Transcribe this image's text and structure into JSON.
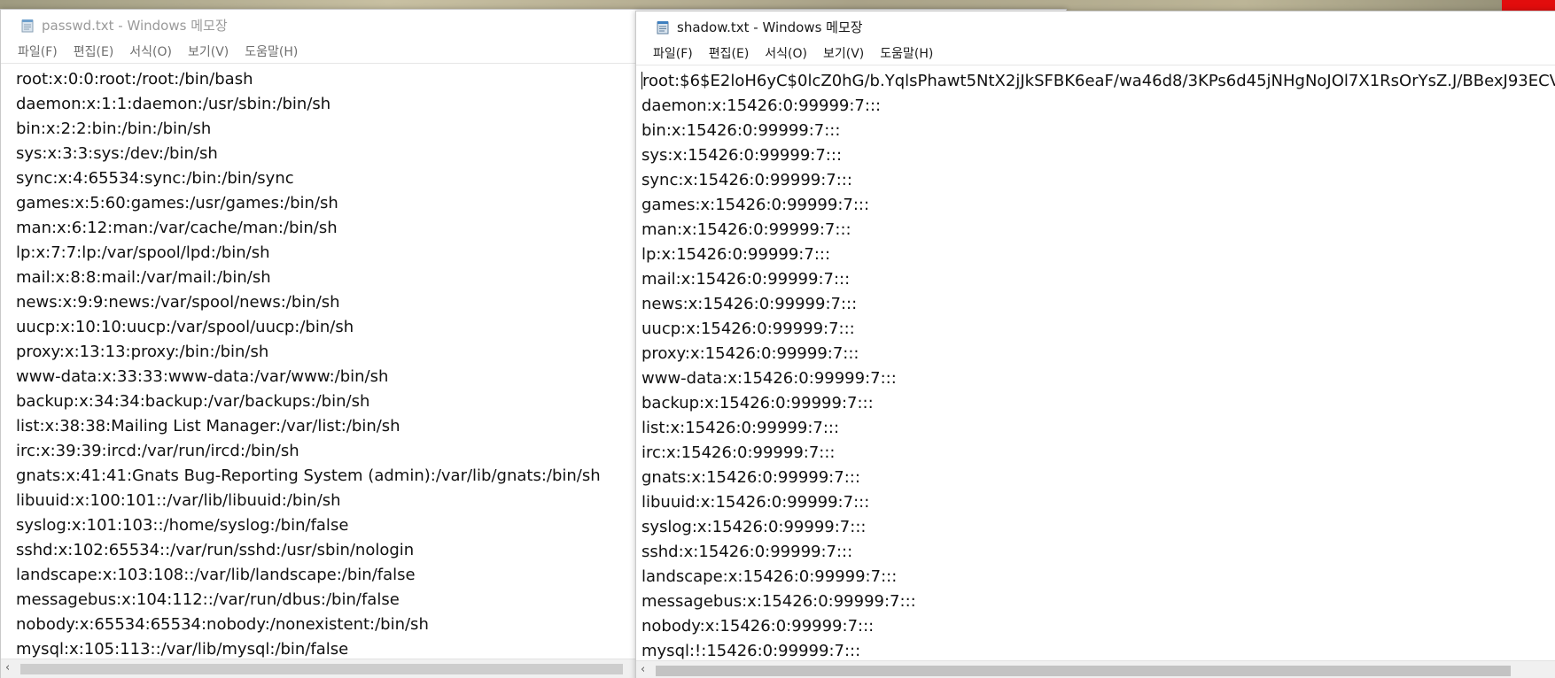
{
  "windows": {
    "passwd": {
      "title": "passwd.txt - Windows 메모장",
      "menu": [
        "파일(F)",
        "편집(E)",
        "서식(O)",
        "보기(V)",
        "도움말(H)"
      ],
      "lines": [
        "root:x:0:0:root:/root:/bin/bash",
        "daemon:x:1:1:daemon:/usr/sbin:/bin/sh",
        "bin:x:2:2:bin:/bin:/bin/sh",
        "sys:x:3:3:sys:/dev:/bin/sh",
        "sync:x:4:65534:sync:/bin:/bin/sync",
        "games:x:5:60:games:/usr/games:/bin/sh",
        "man:x:6:12:man:/var/cache/man:/bin/sh",
        "lp:x:7:7:lp:/var/spool/lpd:/bin/sh",
        "mail:x:8:8:mail:/var/mail:/bin/sh",
        "news:x:9:9:news:/var/spool/news:/bin/sh",
        "uucp:x:10:10:uucp:/var/spool/uucp:/bin/sh",
        "proxy:x:13:13:proxy:/bin:/bin/sh",
        "www-data:x:33:33:www-data:/var/www:/bin/sh",
        "backup:x:34:34:backup:/var/backups:/bin/sh",
        "list:x:38:38:Mailing List Manager:/var/list:/bin/sh",
        "irc:x:39:39:ircd:/var/run/ircd:/bin/sh",
        "gnats:x:41:41:Gnats Bug-Reporting System (admin):/var/lib/gnats:/bin/sh",
        "libuuid:x:100:101::/var/lib/libuuid:/bin/sh",
        "syslog:x:101:103::/home/syslog:/bin/false",
        "sshd:x:102:65534::/var/run/sshd:/usr/sbin/nologin",
        "landscape:x:103:108::/var/lib/landscape:/bin/false",
        "messagebus:x:104:112::/var/run/dbus:/bin/false",
        "nobody:x:65534:65534:nobody:/nonexistent:/bin/sh",
        "mysql:x:105:113::/var/lib/mysql:/bin/false"
      ]
    },
    "shadow": {
      "title": "shadow.txt - Windows 메모장",
      "menu": [
        "파일(F)",
        "편집(E)",
        "서식(O)",
        "보기(V)",
        "도움말(H)"
      ],
      "lines": [
        "root:$6$E2loH6yC$0lcZ0hG/b.YqlsPhawt5NtX2jJkSFBK6eaF/wa46d8/3KPs6d45jNHgNoJOl7X1RsOrYsZ.J/BBexJ93ECV",
        "daemon:x:15426:0:99999:7:::",
        "bin:x:15426:0:99999:7:::",
        "sys:x:15426:0:99999:7:::",
        "sync:x:15426:0:99999:7:::",
        "games:x:15426:0:99999:7:::",
        "man:x:15426:0:99999:7:::",
        "lp:x:15426:0:99999:7:::",
        "mail:x:15426:0:99999:7:::",
        "news:x:15426:0:99999:7:::",
        "uucp:x:15426:0:99999:7:::",
        "proxy:x:15426:0:99999:7:::",
        "www-data:x:15426:0:99999:7:::",
        "backup:x:15426:0:99999:7:::",
        "list:x:15426:0:99999:7:::",
        "irc:x:15426:0:99999:7:::",
        "gnats:x:15426:0:99999:7:::",
        "libuuid:x:15426:0:99999:7:::",
        "syslog:x:15426:0:99999:7:::",
        "sshd:x:15426:0:99999:7:::",
        "landscape:x:15426:0:99999:7:::",
        "messagebus:x:15426:0:99999:7:::",
        "nobody:x:15426:0:99999:7:::",
        "mysql:!:15426:0:99999:7:::"
      ]
    }
  },
  "icons": {
    "app_icon": "notepad-icon",
    "scroll_left": "chevron-left-icon"
  },
  "colors": {
    "active_text": "#1a1a1a",
    "inactive_text": "#9a9a9a",
    "accent_red": "#e20d0d"
  }
}
